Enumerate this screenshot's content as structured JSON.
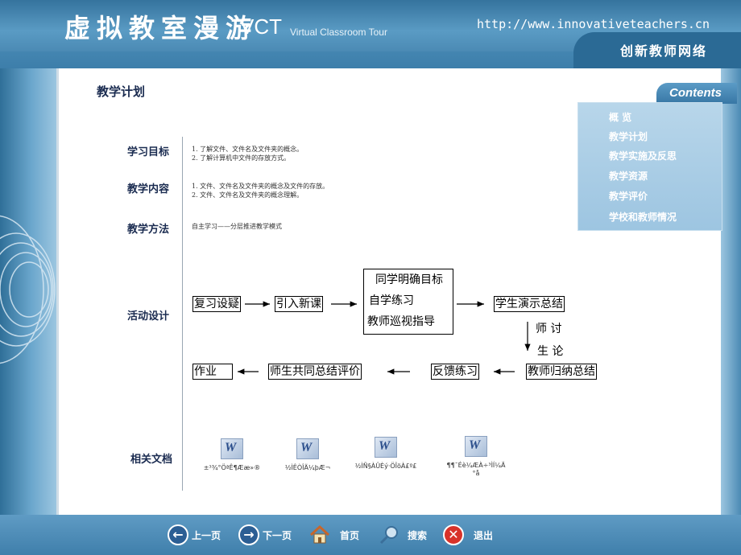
{
  "header": {
    "title_cn": "虚拟教室漫游",
    "title_vct": "VCT",
    "title_en": "Virtual Classroom Tour",
    "url": "http://www.innovativeteachers.cn",
    "org": "创新教师网络"
  },
  "contents": {
    "tab_label": "Contents",
    "items": [
      "概 览",
      "教学计划",
      "教学实施及反思",
      "教学资源",
      "教学评价",
      "学校和教师情况"
    ]
  },
  "page_title": "教学计划",
  "sections": {
    "goals": {
      "label": "学习目标",
      "lines": [
        "1.    了解文件、文件名及文件夹的概念。",
        "2.    了解计算机中文件的存放方式。"
      ]
    },
    "content": {
      "label": "教学内容",
      "lines": [
        "1.    文件、文件名及文件夹的概念及文件的存放。",
        "2.    文件、文件名及文件夹的概念理解。"
      ]
    },
    "method": {
      "label": "教学方法",
      "text": "自主学习——分层推进教学模式"
    },
    "activity": {
      "label": "活动设计"
    },
    "docs": {
      "label": "相关文档"
    }
  },
  "diagram": {
    "box1": "复习设疑",
    "box2": "引入新课",
    "box3_lines": [
      "同学明确目标",
      "自学练习",
      "教师巡视指导"
    ],
    "box4": "学生演示总结",
    "discuss_a": "师    讨",
    "discuss_b": "生    论",
    "box5": "教师归纳总结",
    "box6": "反馈练习",
    "box7": "师生共同总结评价",
    "box8": "作业"
  },
  "documents": [
    {
      "icon": "W",
      "label": "±³¾°ÖªÊ¶Ææ»®"
    },
    {
      "icon": "W",
      "label": "½ÌÊÒÎÄ¼þÆ¬"
    },
    {
      "icon": "W",
      "label": "½ÌÑ§ÀÛÈý·ÖÎöÀ£º£"
    },
    {
      "icon": "W",
      "label": "¶¶¯Éè¼ÆÀ÷³ÌÍ¼Ä",
      "label2": "°å"
    }
  ],
  "footer": {
    "prev": "上一页",
    "next": "下一页",
    "home": "首页",
    "search": "搜索",
    "exit": "退出"
  },
  "colors": {
    "header_blue": "#3d7eaa",
    "label_navy": "#1a2b50",
    "exit_red": "#d8322a"
  }
}
